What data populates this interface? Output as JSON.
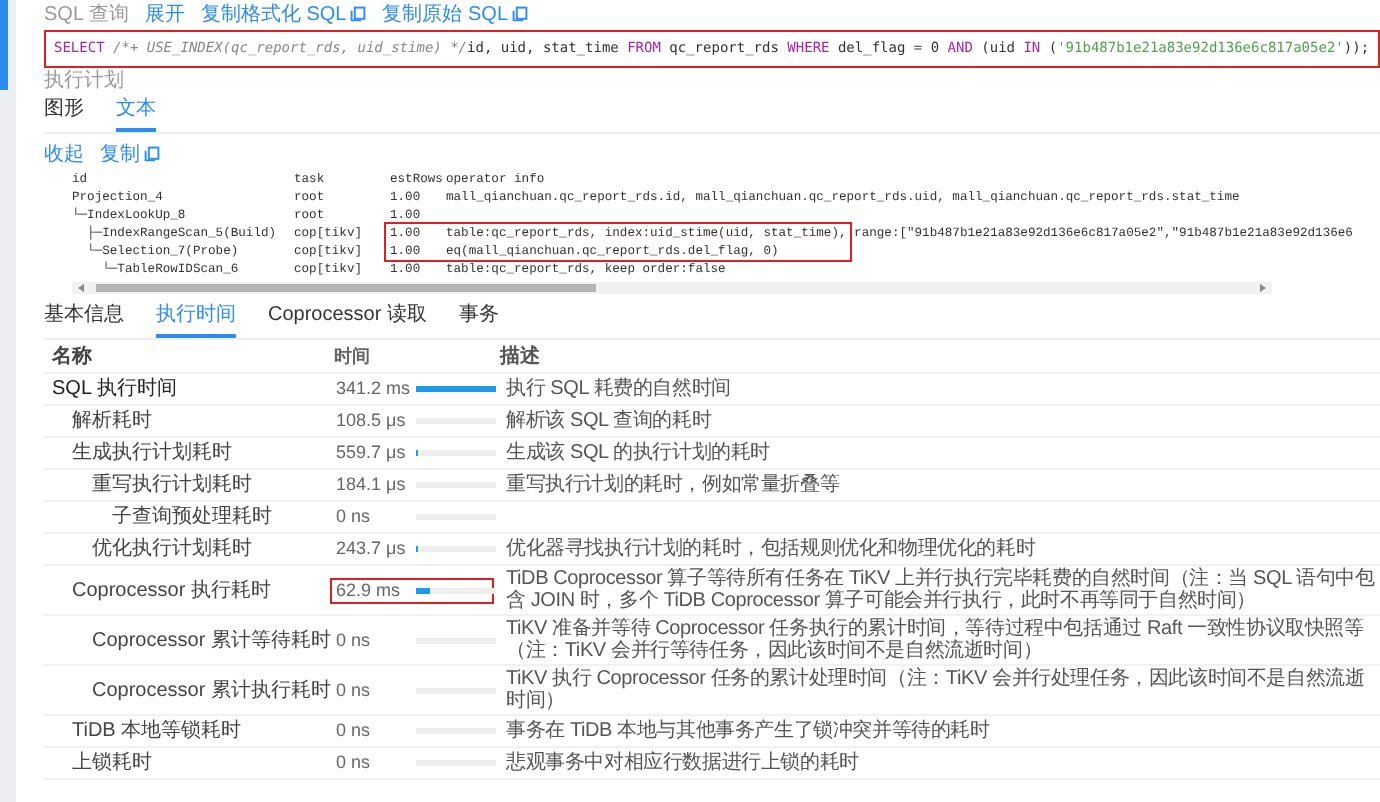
{
  "header": {
    "title": "SQL 查询",
    "links": [
      {
        "label": "展开",
        "icon": false
      },
      {
        "label": "复制格式化 SQL",
        "icon": true
      },
      {
        "label": "复制原始 SQL",
        "icon": true
      }
    ]
  },
  "sql": {
    "highlighted": true,
    "tokens": [
      {
        "kind": "keyword",
        "text": "SELECT"
      },
      {
        "kind": "comment",
        "text": " /*+ USE_INDEX(qc_report_rds, uid_stime) */"
      },
      {
        "kind": "plain",
        "text": "id, uid, stat_time "
      },
      {
        "kind": "keyword",
        "text": "FROM"
      },
      {
        "kind": "plain",
        "text": " qc_report_rds "
      },
      {
        "kind": "keyword",
        "text": "WHERE"
      },
      {
        "kind": "plain",
        "text": " del_flag = 0 "
      },
      {
        "kind": "keyword",
        "text": "AND"
      },
      {
        "kind": "plain",
        "text": " (uid "
      },
      {
        "kind": "keyword",
        "text": "IN"
      },
      {
        "kind": "plain",
        "text": " ("
      },
      {
        "kind": "string",
        "text": "'91b487b1e21a83e92d136e6c817a05e2'"
      },
      {
        "kind": "plain",
        "text": "));"
      }
    ]
  },
  "plan": {
    "label": "执行计划",
    "tabs": [
      {
        "label": "图形",
        "selected": false
      },
      {
        "label": "文本",
        "selected": true
      }
    ],
    "actions": [
      {
        "label": "收起",
        "icon": false
      },
      {
        "label": "复制",
        "icon": true
      }
    ],
    "columns": [
      "id",
      "task",
      "estRows",
      "operator info"
    ],
    "rows": [
      {
        "id": "Projection_4",
        "task": "root",
        "est_rows": "1.00",
        "operator_info": "mall_qianchuan.qc_report_rds.id, mall_qianchuan.qc_report_rds.uid, mall_qianchuan.qc_report_rds.stat_time",
        "highlighted": false
      },
      {
        "id": "└─IndexLookUp_8",
        "task": "root",
        "est_rows": "1.00",
        "operator_info": "",
        "highlighted": false
      },
      {
        "id": "  ├─IndexRangeScan_5(Build)",
        "task": "cop[tikv]",
        "est_rows": "1.00",
        "operator_info": "table:qc_report_rds, index:uid_stime(uid, stat_time), range:[\"91b487b1e21a83e92d136e6c817a05e2\",\"91b487b1e21a83e92d136e6",
        "highlighted": true
      },
      {
        "id": "  └─Selection_7(Probe)",
        "task": "cop[tikv]",
        "est_rows": "1.00",
        "operator_info": "eq(mall_qianchuan.qc_report_rds.del_flag, 0)",
        "highlighted": true
      },
      {
        "id": "    └─TableRowIDScan_6",
        "task": "cop[tikv]",
        "est_rows": "1.00",
        "operator_info": "table:qc_report_rds, keep order:false",
        "highlighted": false
      }
    ]
  },
  "detail": {
    "tabs": [
      {
        "label": "基本信息",
        "selected": false
      },
      {
        "label": "执行时间",
        "selected": true
      },
      {
        "label": "Coprocessor 读取",
        "selected": false
      },
      {
        "label": "事务",
        "selected": false
      }
    ],
    "columns": [
      "名称",
      "时间",
      "描述"
    ],
    "rows": [
      {
        "name": "SQL 执行时间",
        "time": "341.2 ms",
        "level": 1,
        "description": "执行 SQL 耗费的自然时间",
        "highlighted": false,
        "children": [
          {
            "name": "解析耗时",
            "time": "108.5 μs",
            "level": 0,
            "description": "解析该 SQL 查询的耗时",
            "highlighted": false
          },
          {
            "name": "生成执行计划耗时",
            "time": "559.7 μs",
            "level": 0.01,
            "description": "生成该 SQL 的执行计划的耗时",
            "highlighted": false,
            "children": [
              {
                "name": "重写执行计划耗时",
                "time": "184.1 μs",
                "level": 0,
                "description": "重写执行计划的耗时，例如常量折叠等",
                "highlighted": false,
                "children": [
                  {
                    "name": "子查询预处理耗时",
                    "time": "0 ns",
                    "level": 0,
                    "highlighted": false
                  }
                ]
              },
              {
                "name": "优化执行计划耗时",
                "time": "243.7 μs",
                "level": 0.01,
                "description": "优化器寻找执行计划的耗时，包括规则优化和物理优化的耗时",
                "highlighted": false
              }
            ]
          },
          {
            "name": "Coprocessor 执行耗时",
            "time": "62.9 ms",
            "level": 0.18,
            "description": "TiDB Coprocessor 算子等待所有任务在 TiKV 上并行执行完毕耗费的自然时间（注：当 SQL 语句中包含 JOIN 时，多个 TiDB Coprocessor 算子可能会并行执行，此时不再等同于自然时间）",
            "highlighted": true,
            "children": [
              {
                "name": "Coprocessor 累计等待耗时",
                "time": "0 ns",
                "level": 0,
                "description": "TiKV 准备并等待 Coprocessor 任务执行的累计时间，等待过程中包括通过 Raft 一致性协议取快照等（注：TiKV 会并行等待任务，因此该时间不是自然流逝时间）",
                "highlighted": false
              },
              {
                "name": "Coprocessor 累计执行耗时",
                "time": "0 ns",
                "level": 0,
                "description": "TiKV 执行 Coprocessor 任务的累计处理时间（注：TiKV 会并行处理任务，因此该时间不是自然流逝时间）",
                "highlighted": false
              }
            ]
          },
          {
            "name": "TiDB 本地等锁耗时",
            "time": "0 ns",
            "level": 0,
            "description": "事务在 TiDB 本地与其他事务产生了锁冲突并等待的耗时",
            "highlighted": false
          },
          {
            "name": "上锁耗时",
            "time": "0 ns",
            "level": 0,
            "description": "悲观事务中对相应行数据进行上锁的耗时",
            "highlighted": false
          }
        ]
      }
    ]
  }
}
